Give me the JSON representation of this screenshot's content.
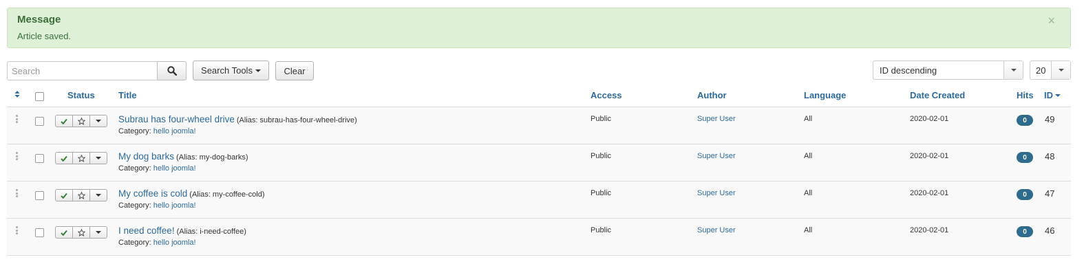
{
  "message": {
    "heading": "Message",
    "text": "Article saved.",
    "close_glyph": "×"
  },
  "filters": {
    "search_placeholder": "Search",
    "search_tools_label": "Search Tools",
    "clear_label": "Clear",
    "ordering_value": "ID descending",
    "limit_value": "20"
  },
  "table": {
    "headers": {
      "status": "Status",
      "title": "Title",
      "access": "Access",
      "author": "Author",
      "language": "Language",
      "date_created": "Date Created",
      "hits": "Hits",
      "id": "ID"
    },
    "category_prefix": "Category:",
    "rows": [
      {
        "title": "Subrau has four-wheel drive",
        "alias": "(Alias: subrau-has-four-wheel-drive)",
        "category": "hello joomla!",
        "access": "Public",
        "author": "Super User",
        "language": "All",
        "date_created": "2020-02-01",
        "hits": "0",
        "id": "49"
      },
      {
        "title": "My dog barks",
        "alias": "(Alias: my-dog-barks)",
        "category": "hello joomla!",
        "access": "Public",
        "author": "Super User",
        "language": "All",
        "date_created": "2020-02-01",
        "hits": "0",
        "id": "48"
      },
      {
        "title": "My coffee is cold",
        "alias": "(Alias: my-coffee-cold)",
        "category": "hello joomla!",
        "access": "Public",
        "author": "Super User",
        "language": "All",
        "date_created": "2020-02-01",
        "hits": "0",
        "id": "47"
      },
      {
        "title": "I need coffee!",
        "alias": "(Alias: i-need-coffee)",
        "category": "hello joomla!",
        "access": "Public",
        "author": "Super User",
        "language": "All",
        "date_created": "2020-02-01",
        "hits": "0",
        "id": "46"
      }
    ]
  },
  "colors": {
    "link": "#2c6aa0",
    "message_bg": "#dff0d8",
    "message_text": "#3c6e3a",
    "hits_badge": "#2f6b8c",
    "publish_check": "#378137"
  },
  "icons": {
    "close": "close-icon",
    "search": "search-icon",
    "sort": "sort-icon",
    "drag": "drag-handle-icon",
    "published": "check-icon",
    "featured": "star-icon",
    "actions": "caret-down-icon"
  }
}
